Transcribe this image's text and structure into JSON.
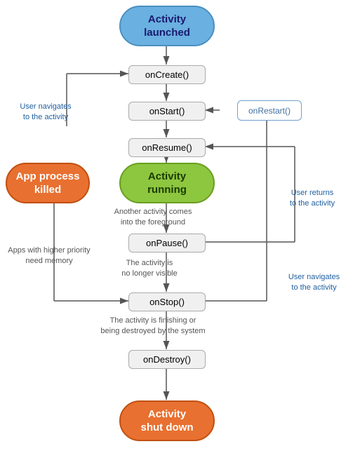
{
  "nodes": {
    "activity_launched": {
      "label": "Activity\nlaunched"
    },
    "onCreate": {
      "label": "onCreate()"
    },
    "onStart": {
      "label": "onStart()"
    },
    "onResume": {
      "label": "onResume()"
    },
    "activity_running": {
      "label": "Activity\nrunning"
    },
    "onPause": {
      "label": "onPause()"
    },
    "onStop": {
      "label": "onStop()"
    },
    "onDestroy": {
      "label": "onDestroy()"
    },
    "activity_shutdown": {
      "label": "Activity\nshut down"
    },
    "onRestart": {
      "label": "onRestart()"
    },
    "app_killed": {
      "label": "App process\nkilled"
    }
  },
  "labels": {
    "user_navigates_to": "User navigates\nto the activity",
    "another_activity": "Another activity comes\ninto the foreground",
    "apps_higher_priority": "Apps with higher priority\nneed memory",
    "activity_no_longer": "The activity is\nno longer visible",
    "activity_finishing": "The activity is finishing or\nbeing destroyed by the system",
    "user_returns": "User returns\nto the activity",
    "user_navigates_to2": "User navigates\nto the activity"
  }
}
